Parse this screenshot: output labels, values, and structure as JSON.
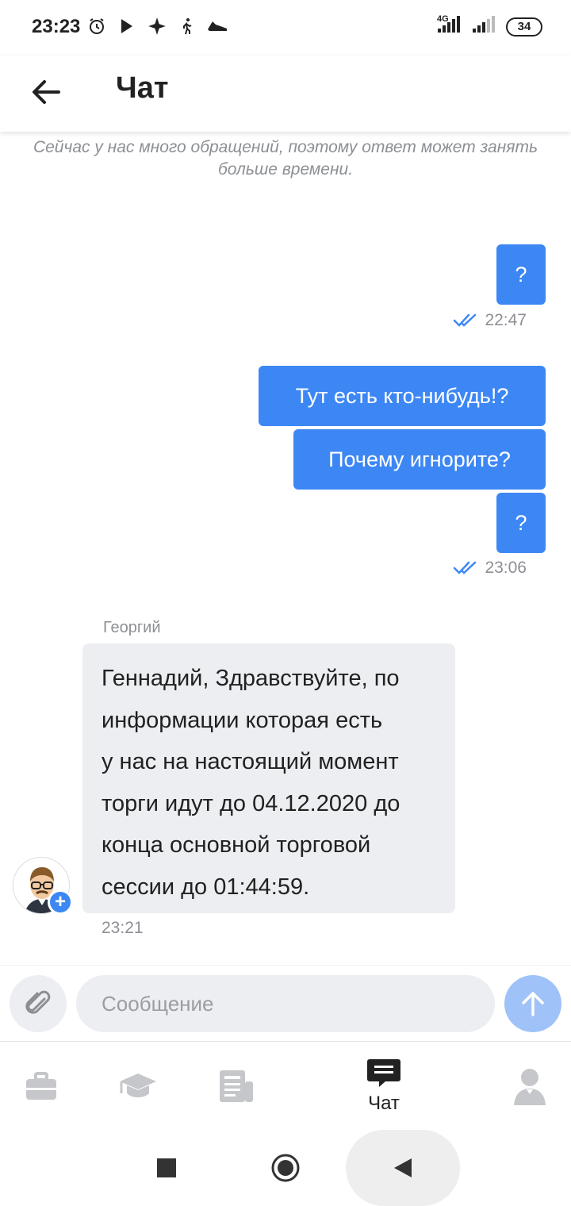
{
  "status_bar": {
    "time": "23:23",
    "network": "4G",
    "battery": "34"
  },
  "header": {
    "title": "Чат"
  },
  "chat": {
    "system_note": "Сейчас у нас много обращений, поэтому ответ может занять больше времени.",
    "outgoing": [
      {
        "text": "?",
        "group": 1
      },
      {
        "time": "22:47"
      },
      {
        "text": "Тут есть кто-нибудь!?",
        "group": 2
      },
      {
        "text": "Почему игнорите?",
        "group": 2
      },
      {
        "text": "?",
        "group": 2
      },
      {
        "time": "23:06"
      }
    ],
    "out_group1": {
      "msg1": "?",
      "time": "22:47"
    },
    "out_group2": {
      "msg1": "Тут есть кто-нибудь!?",
      "msg2": "Почему игнорите?",
      "msg3": "?",
      "time": "23:06"
    },
    "incoming": {
      "sender": "Георгий",
      "lines": [
        "Геннадий, Здравствуйте,  по",
        "информации которая есть",
        "у нас на настоящий момент",
        "торги идут до 04.12.2020  до",
        "конца основной торговой",
        "сессии до 01:44:59."
      ],
      "time": "23:21"
    }
  },
  "composer": {
    "placeholder": "Сообщение",
    "value": ""
  },
  "bottom_nav": {
    "items": [
      {
        "icon": "briefcase-icon",
        "label": ""
      },
      {
        "icon": "graduation-cap-icon",
        "label": ""
      },
      {
        "icon": "news-icon",
        "label": ""
      },
      {
        "icon": "chat-icon",
        "label": "Чат"
      },
      {
        "icon": "profile-icon",
        "label": ""
      }
    ]
  },
  "colors": {
    "accent": "#3d87f5",
    "incoming_bubble": "#eceef1",
    "muted_text": "#8c8f94"
  }
}
